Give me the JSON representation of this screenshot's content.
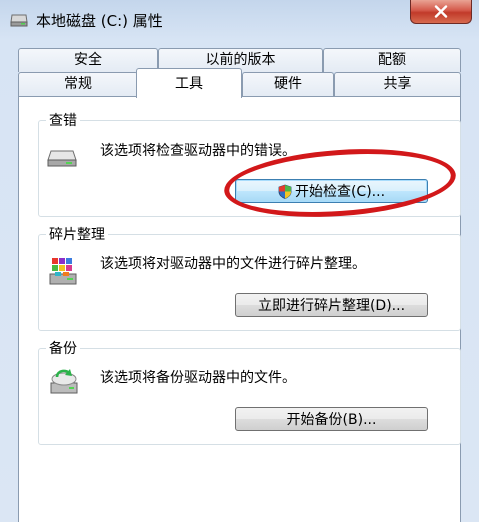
{
  "window": {
    "title": "本地磁盘 (C:) 属性",
    "colors": {
      "accent": "#3c7fb1",
      "close": "#c13a2a",
      "annotation": "#d2181a"
    }
  },
  "tabs": {
    "row_back": [
      {
        "label": "安全"
      },
      {
        "label": "以前的版本"
      },
      {
        "label": "配额"
      }
    ],
    "row_front": [
      {
        "label": "常规"
      },
      {
        "label": "工具",
        "active": true
      },
      {
        "label": "硬件"
      },
      {
        "label": "共享"
      }
    ]
  },
  "groups": {
    "error_check": {
      "title": "查错",
      "description": "该选项将检查驱动器中的错误。",
      "button": "开始检查(C)...",
      "icon": "hard-drive-icon"
    },
    "defrag": {
      "title": "碎片整理",
      "description": "该选项将对驱动器中的文件进行碎片整理。",
      "button": "立即进行碎片整理(D)...",
      "icon": "defrag-icon"
    },
    "backup": {
      "title": "备份",
      "description": "该选项将备份驱动器中的文件。",
      "button": "开始备份(B)...",
      "icon": "backup-icon"
    }
  }
}
